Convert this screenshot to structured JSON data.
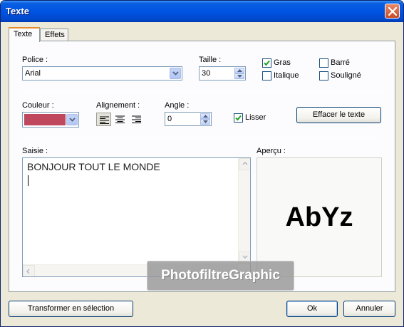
{
  "window": {
    "title": "Texte"
  },
  "tabs": [
    {
      "label": "Texte",
      "active": true
    },
    {
      "label": "Effets",
      "active": false
    }
  ],
  "font": {
    "label": "Police :",
    "value": "Arial"
  },
  "size": {
    "label": "Taille :",
    "value": "30"
  },
  "styles": {
    "bold": {
      "label": "Gras",
      "checked": true
    },
    "italic": {
      "label": "Italique",
      "checked": false
    },
    "strike": {
      "label": "Barré",
      "checked": false
    },
    "underline": {
      "label": "Souligné",
      "checked": false
    }
  },
  "color": {
    "label": "Couleur :",
    "value": "#c0485e"
  },
  "alignment": {
    "label": "Alignement :",
    "options": [
      "left",
      "center",
      "right"
    ],
    "selected": "left"
  },
  "angle": {
    "label": "Angle :",
    "value": "0"
  },
  "smooth": {
    "label": "Lisser",
    "checked": true
  },
  "clear_button": "Effacer le texte",
  "input": {
    "label": "Saisie :",
    "value": "BONJOUR TOUT LE MONDE"
  },
  "preview": {
    "label": "Aperçu :",
    "sample": "AbYz"
  },
  "footer": {
    "transform_button": "Transformer en sélection",
    "ok_button": "Ok",
    "cancel_button": "Annuler"
  },
  "watermark": "PhotofiltreGraphic"
}
